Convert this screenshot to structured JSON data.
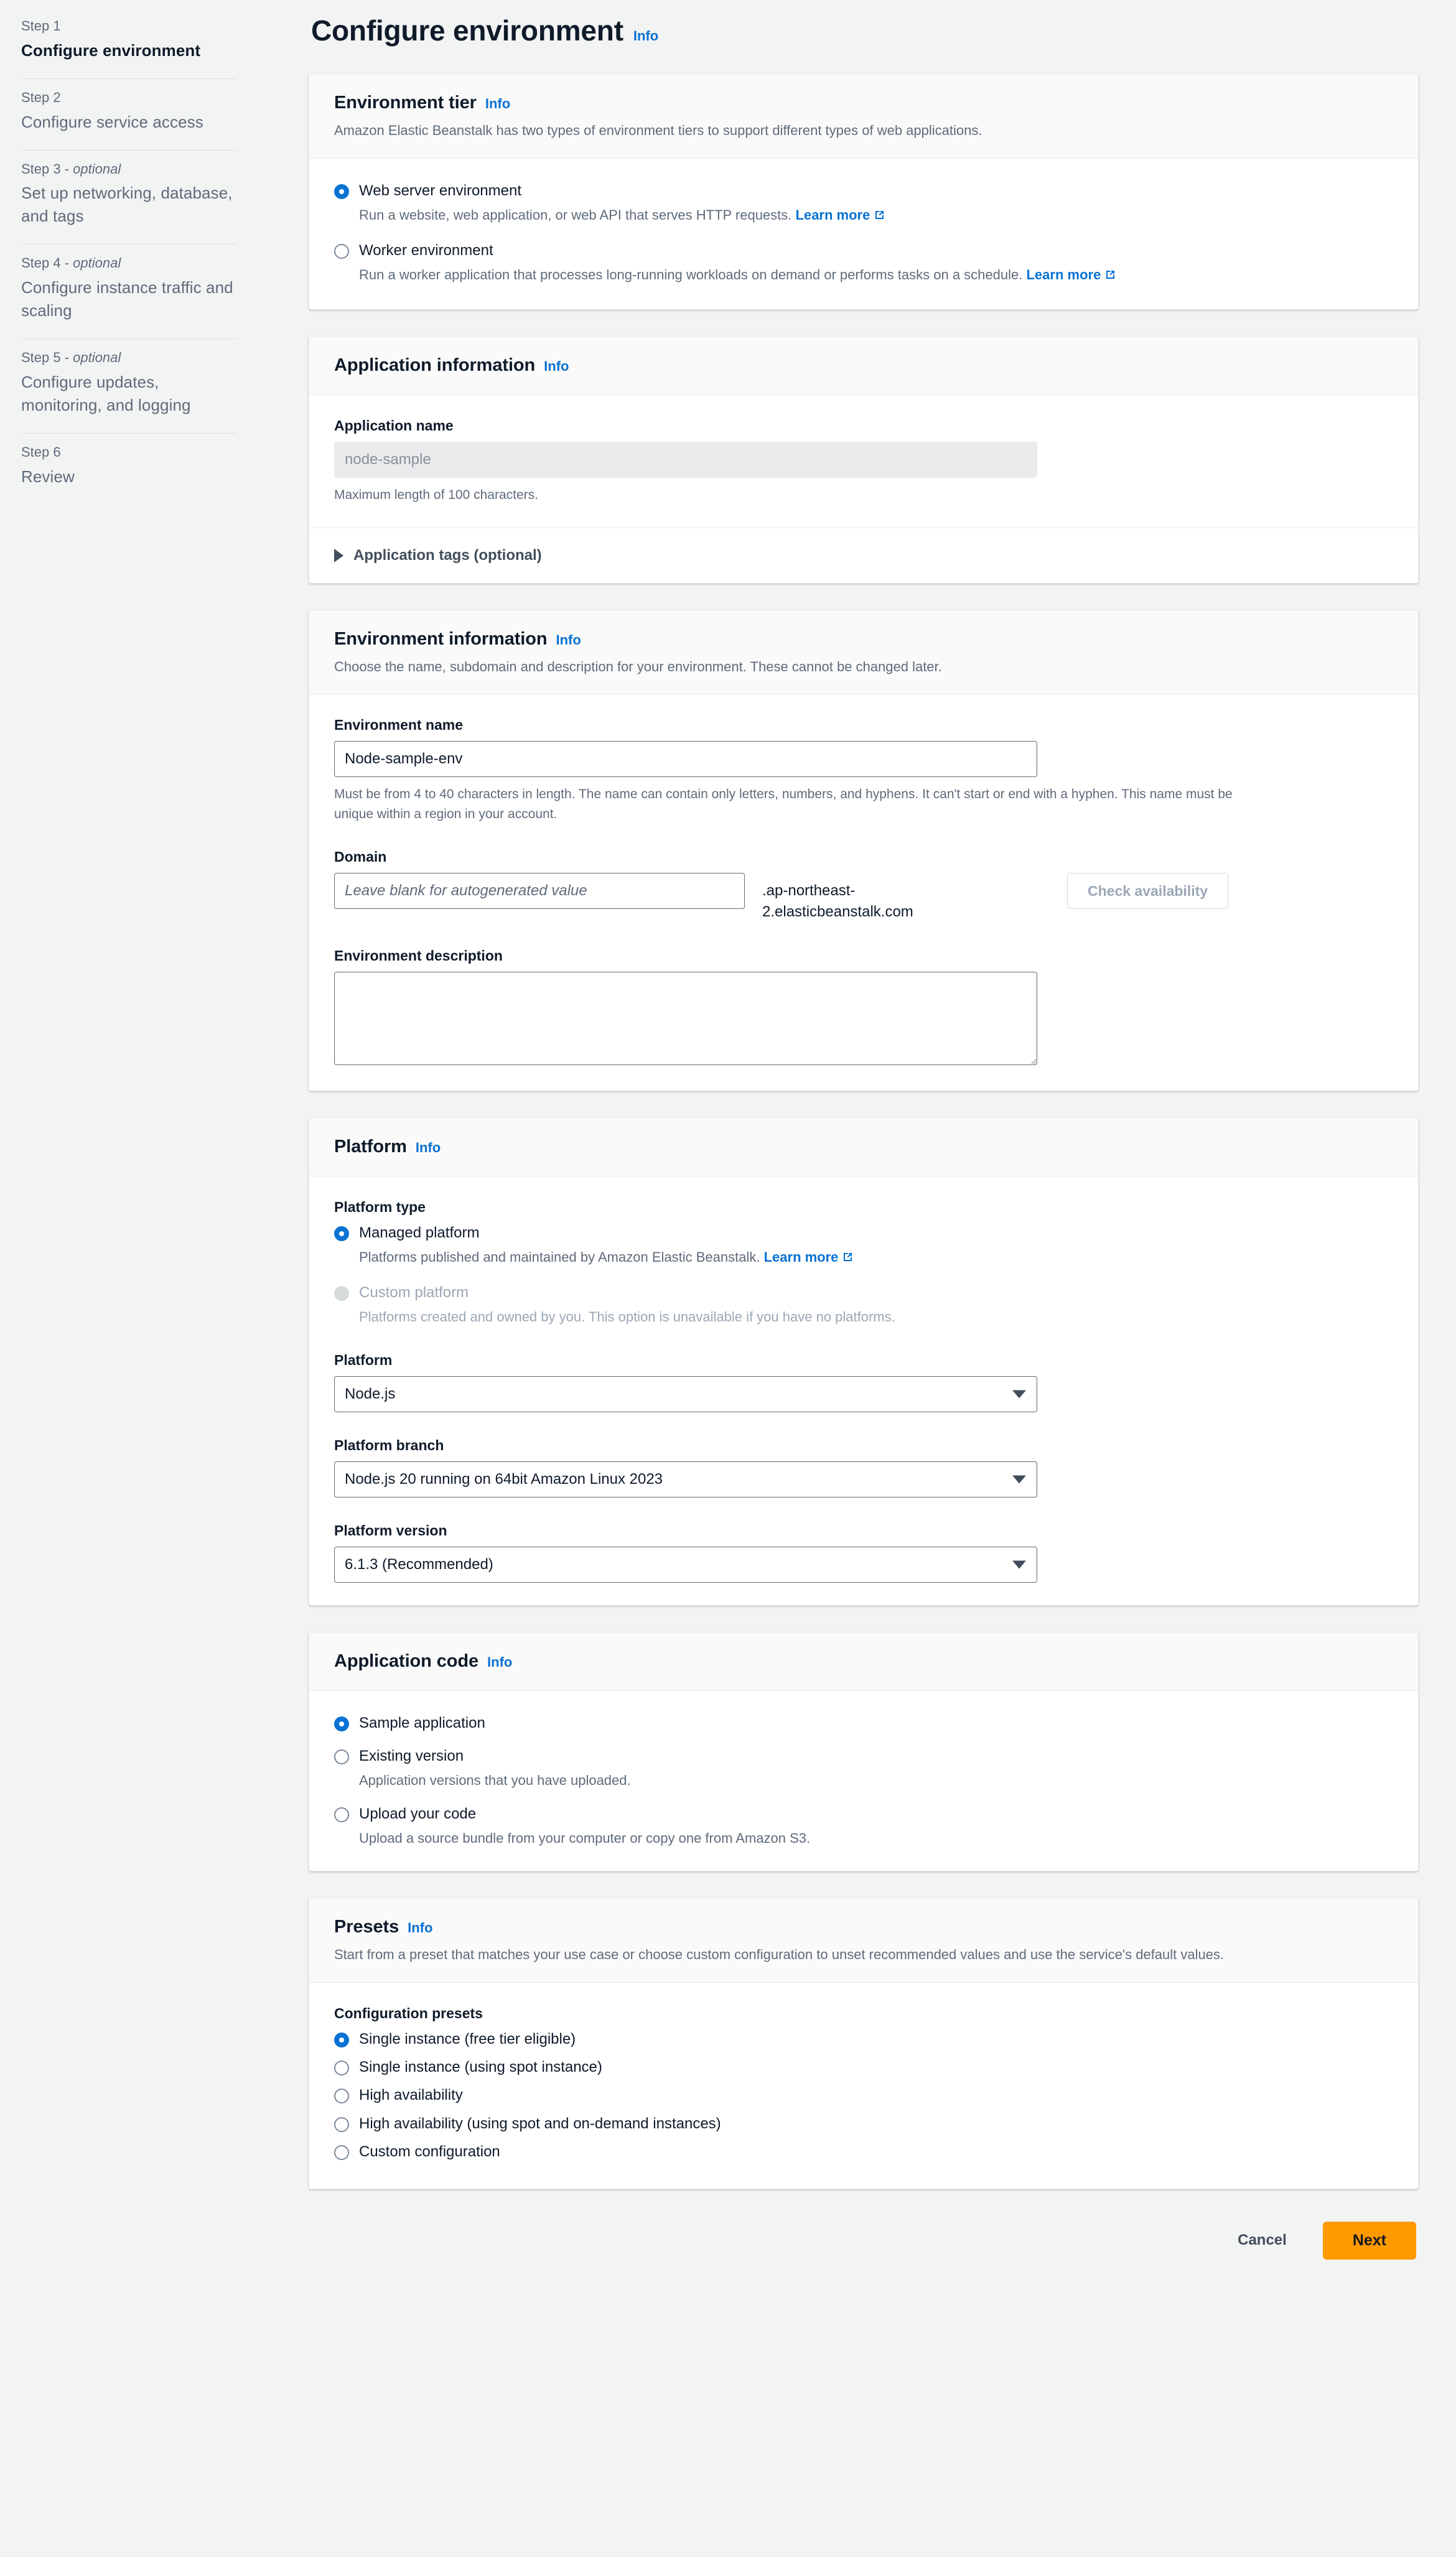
{
  "header": {
    "title": "Configure environment",
    "info_label": "Info"
  },
  "sidebar": {
    "steps": [
      {
        "eyebrow": "Step 1",
        "optional": "",
        "title": "Configure environment",
        "current": true
      },
      {
        "eyebrow": "Step 2",
        "optional": "",
        "title": "Configure service access",
        "current": false
      },
      {
        "eyebrow": "Step 3 -",
        "optional": "optional",
        "title": "Set up networking, database, and tags",
        "current": false
      },
      {
        "eyebrow": "Step 4 -",
        "optional": "optional",
        "title": "Configure instance traffic and scaling",
        "current": false
      },
      {
        "eyebrow": "Step 5 -",
        "optional": "optional",
        "title": "Configure updates, monitoring, and logging",
        "current": false
      },
      {
        "eyebrow": "Step 6",
        "optional": "",
        "title": "Review",
        "current": false
      }
    ]
  },
  "environment_tier": {
    "title": "Environment tier",
    "info_label": "Info",
    "description": "Amazon Elastic Beanstalk has two types of environment tiers to support different types of web applications.",
    "options": [
      {
        "label": "Web server environment",
        "description": "Run a website, web application, or web API that serves HTTP requests.",
        "link_label": "Learn more",
        "selected": true
      },
      {
        "label": "Worker environment",
        "description": "Run a worker application that processes long-running workloads on demand or performs tasks on a schedule.",
        "link_label": "Learn more",
        "selected": false
      }
    ]
  },
  "application_information": {
    "title": "Application information",
    "info_label": "Info",
    "application_name": {
      "label": "Application name",
      "value": "",
      "placeholder": "node-sample",
      "hint": "Maximum length of 100 characters.",
      "readonly": true
    },
    "tags_expandable_label": "Application tags (optional)"
  },
  "environment_information": {
    "title": "Environment information",
    "info_label": "Info",
    "description": "Choose the name, subdomain and description for your environment. These cannot be changed later.",
    "environment_name": {
      "label": "Environment name",
      "value": "Node-sample-env",
      "placeholder": "",
      "hint": "Must be from 4 to 40 characters in length. The name can contain only letters, numbers, and hyphens. It can't start or end with a hyphen. This name must be unique within a region in your account."
    },
    "domain": {
      "label": "Domain",
      "value": "",
      "placeholder": "Leave blank for autogenerated value",
      "suffix": ".ap-northeast-2.elasticbeanstalk.com",
      "check_button_label": "Check availability"
    },
    "environment_description": {
      "label": "Environment description",
      "value": "",
      "placeholder": ""
    }
  },
  "platform": {
    "title": "Platform",
    "info_label": "Info",
    "platform_type": {
      "label": "Platform type",
      "options": [
        {
          "label": "Managed platform",
          "description": "Platforms published and maintained by Amazon Elastic Beanstalk.",
          "link_label": "Learn more",
          "selected": true,
          "disabled": false
        },
        {
          "label": "Custom platform",
          "description": "Platforms created and owned by you. This option is unavailable if you have no platforms.",
          "link_label": "",
          "selected": false,
          "disabled": true
        }
      ]
    },
    "platform_select": {
      "label": "Platform",
      "value": "Node.js"
    },
    "platform_branch_select": {
      "label": "Platform branch",
      "value": "Node.js 20 running on 64bit Amazon Linux 2023"
    },
    "platform_version_select": {
      "label": "Platform version",
      "value": "6.1.3 (Recommended)"
    }
  },
  "application_code": {
    "title": "Application code",
    "info_label": "Info",
    "options": [
      {
        "label": "Sample application",
        "description": "",
        "selected": true
      },
      {
        "label": "Existing version",
        "description": "Application versions that you have uploaded.",
        "selected": false
      },
      {
        "label": "Upload your code",
        "description": "Upload a source bundle from your computer or copy one from Amazon S3.",
        "selected": false
      }
    ]
  },
  "presets": {
    "title": "Presets",
    "info_label": "Info",
    "description": "Start from a preset that matches your use case or choose custom configuration to unset recommended values and use the service's default values.",
    "group_label": "Configuration presets",
    "options": [
      {
        "label": "Single instance (free tier eligible)",
        "selected": true
      },
      {
        "label": "Single instance (using spot instance)",
        "selected": false
      },
      {
        "label": "High availability",
        "selected": false
      },
      {
        "label": "High availability (using spot and on-demand instances)",
        "selected": false
      },
      {
        "label": "Custom configuration",
        "selected": false
      }
    ]
  },
  "footer": {
    "cancel_label": "Cancel",
    "next_label": "Next"
  },
  "colors": {
    "accent_blue": "#0972d3",
    "action_orange": "#ff9900",
    "page_bg": "#f2f3f3"
  }
}
